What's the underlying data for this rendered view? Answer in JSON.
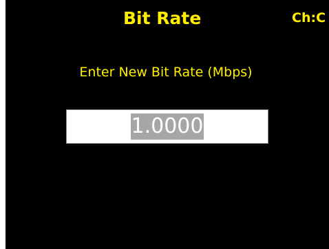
{
  "screen": {
    "title": "Bit Rate",
    "channel": "Ch:C",
    "prompt": "Enter New Bit Rate (Mbps)",
    "input": {
      "value": "1.0000",
      "selected": true
    }
  },
  "colors": {
    "background": "#000000",
    "text_accent": "#ffee00",
    "input_background": "#ffffff",
    "selection_highlight": "#a6a6a6"
  }
}
